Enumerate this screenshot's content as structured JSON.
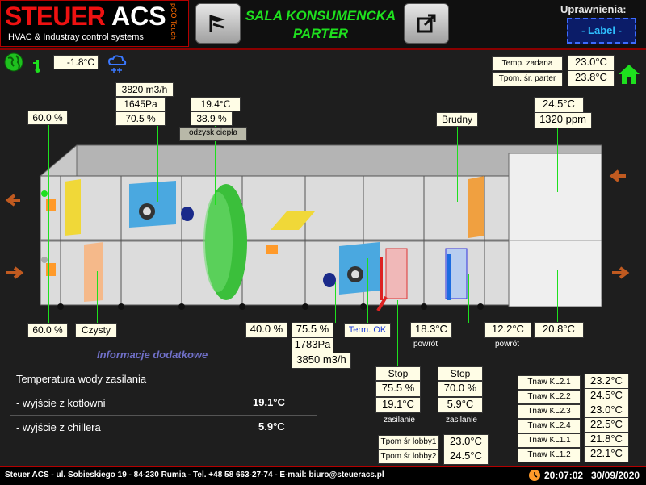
{
  "header": {
    "logo_brand": "STEUER",
    "logo_brand2": "ACS",
    "logo_pco": "pCO Touch",
    "logo_sub": "HVAC & Industray control systems",
    "title_line1": "SALA KONSUMENCKA",
    "title_line2": "PARTER",
    "permissions_label": "Uprawnienia:",
    "permissions_value": "- Label -"
  },
  "outdoor": {
    "temperature": "-1.8°C"
  },
  "setpoints": {
    "temp_zadana_label": "Temp. zadana",
    "temp_zadana_value": "23.0°C",
    "tpom_parter_label": "Tpom. śr. parter",
    "tpom_parter_value": "23.8°C"
  },
  "supply_fan": {
    "flow": "3820 m3/h",
    "pressure": "1645Pa",
    "speed": "70.5 %"
  },
  "heat_recovery": {
    "temp": "19.4°C",
    "percent": "38.9 %",
    "label": "odzysk ciepła"
  },
  "dampers": {
    "exhaust_left": "60.0 %",
    "intake_left": "60.0 %",
    "mixing": "40.0 %"
  },
  "filters": {
    "clean_label": "Czysty",
    "dirty_label": "Brudny"
  },
  "exhaust_side": {
    "temp": "24.5°C",
    "co2": "1320 ppm",
    "supply_temp": "20.8°C"
  },
  "exhaust_fan": {
    "speed": "75.5 %",
    "pressure": "1783Pa",
    "flow": "3850 m3/h"
  },
  "thermostat": {
    "label": "Term. OK"
  },
  "heater": {
    "return_temp": "18.3°C",
    "return_label": "powrót",
    "pump_status": "Stop",
    "valve": "75.5 %",
    "supply_temp": "19.1°C",
    "supply_label": "zasilanie"
  },
  "cooler": {
    "return_temp": "12.2°C",
    "return_label": "powrót",
    "pump_status": "Stop",
    "valve": "70.0 %",
    "supply_temp": "5.9°C",
    "supply_label": "zasilanie"
  },
  "info": {
    "title": "Informacje dodatkowe",
    "row1_label": "Temperatura wody zasilania",
    "row2_label": "- wyjście z kotłowni",
    "row2_value": "19.1°C",
    "row3_label": "- wyjście z chillera",
    "row3_value": "5.9°C"
  },
  "lobby": [
    {
      "label": "Tpom śr lobby1",
      "value": "23.0°C"
    },
    {
      "label": "Tpom śr lobby2",
      "value": "24.5°C"
    }
  ],
  "zones": [
    {
      "label": "Tnaw KL2.1",
      "value": "23.2°C"
    },
    {
      "label": "Tnaw KL2.2",
      "value": "24.5°C"
    },
    {
      "label": "Tnaw KL2.3",
      "value": "23.0°C"
    },
    {
      "label": "Tnaw KL2.4",
      "value": "22.5°C"
    },
    {
      "label": "Tnaw KL1.1",
      "value": "21.8°C"
    },
    {
      "label": "Tnaw KL1.2",
      "value": "22.1°C"
    }
  ],
  "footer": {
    "address": "Steuer ACS - ul. Sobieskiego 19 - 84-230 Rumia - Tel. +48 58 663-27-74 - E-mail: biuro@steueracs.pl",
    "time": "20:07:02",
    "date": "30/09/2020"
  },
  "colors": {
    "accent_green": "#1ee01e",
    "brand_red": "#e11111",
    "panel_bg": "#1e1e1e"
  }
}
